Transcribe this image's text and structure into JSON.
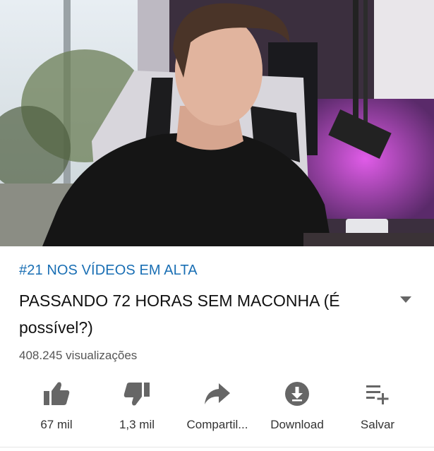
{
  "video": {
    "thumbnail_icon": "video-frame"
  },
  "trending": "#21 NOS VÍDEOS EM ALTA",
  "title": "PASSANDO 72 HORAS SEM MACONHA (É possível?)",
  "views": "408.245 visualizações",
  "actions": {
    "like": {
      "label": "67 mil",
      "icon": "thumbs-up-icon"
    },
    "dislike": {
      "label": "1,3 mil",
      "icon": "thumbs-down-icon"
    },
    "share": {
      "label": "Compartil...",
      "icon": "share-icon"
    },
    "download": {
      "label": "Download",
      "icon": "download-icon"
    },
    "save": {
      "label": "Salvar",
      "icon": "playlist-add-icon"
    }
  },
  "colors": {
    "trending": "#1a6fb4",
    "icon": "#666666",
    "text": "#111111"
  }
}
